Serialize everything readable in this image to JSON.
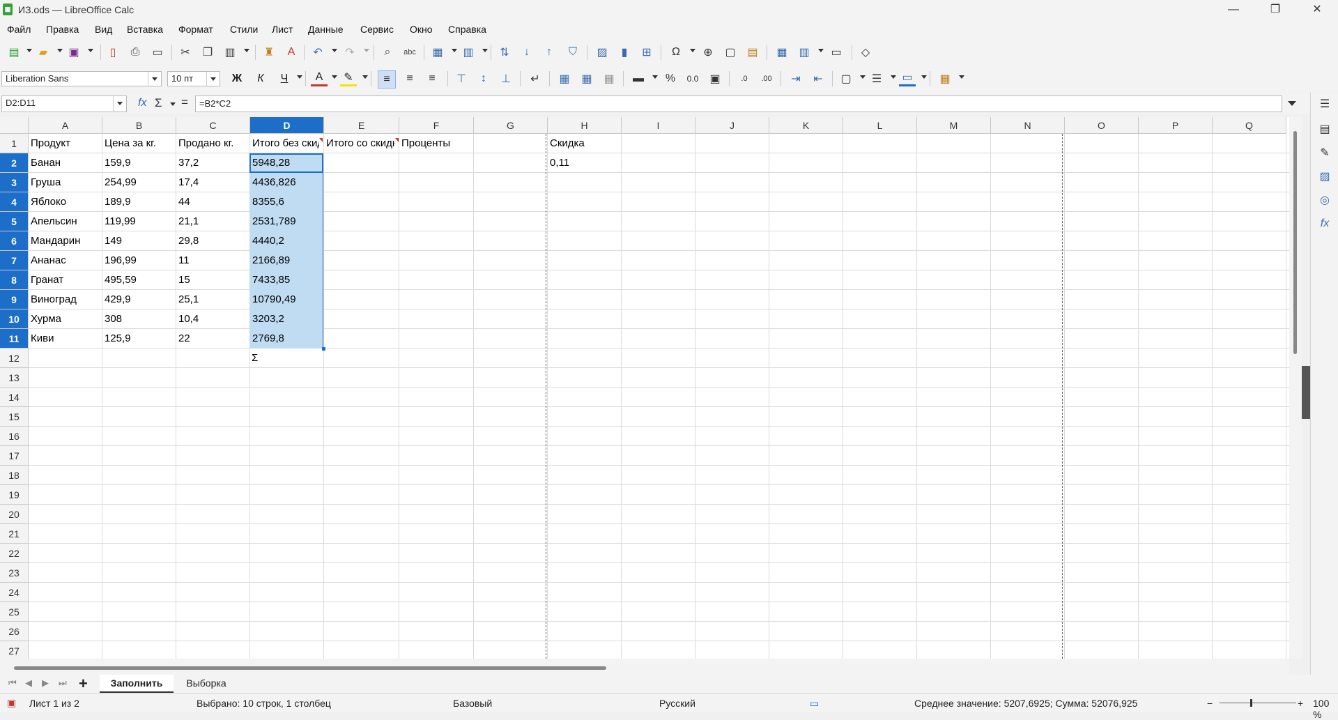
{
  "window": {
    "title": "ИЗ.ods — LibreOffice Calc",
    "minimize": "—",
    "restore": "❐",
    "close": "✕"
  },
  "menu": [
    "Файл",
    "Правка",
    "Вид",
    "Вставка",
    "Формат",
    "Стили",
    "Лист",
    "Данные",
    "Сервис",
    "Окно",
    "Справка"
  ],
  "format_bar": {
    "font_name": "Liberation Sans",
    "font_size": "10 пт",
    "bold": "Ж",
    "italic": "К",
    "underline": "Ч",
    "percent": "%",
    "number": "0.0"
  },
  "formula_bar": {
    "name_box": "D2:D11",
    "fx": "fx",
    "sigma": "Σ",
    "equals": "=",
    "formula": "=B2*C2"
  },
  "columns": [
    "A",
    "B",
    "C",
    "D",
    "E",
    "F",
    "G",
    "H",
    "I",
    "J",
    "K",
    "L",
    "M",
    "N",
    "O",
    "P",
    "Q"
  ],
  "selected_column": "D",
  "rows": [
    "1",
    "2",
    "3",
    "4",
    "5",
    "6",
    "7",
    "8",
    "9",
    "10",
    "11",
    "12",
    "13",
    "14",
    "15",
    "16",
    "17",
    "18",
    "19",
    "20",
    "21",
    "22",
    "23",
    "24",
    "25",
    "26",
    "27"
  ],
  "header_row": {
    "A": "Продукт",
    "B": "Цена за кг.",
    "C": "Продано кг.",
    "D": "Итого без скидки",
    "E": "Итого со скидкой",
    "F": "Проценты",
    "H": "Скидка"
  },
  "data_rows": [
    {
      "A": "Банан",
      "B": "159,9",
      "C": "37,2",
      "D": "5948,28",
      "H": "0,11"
    },
    {
      "A": "Груша",
      "B": "254,99",
      "C": "17,4",
      "D": "4436,826"
    },
    {
      "A": "Яблоко",
      "B": "189,9",
      "C": "44",
      "D": "8355,6"
    },
    {
      "A": "Апельсин",
      "B": "119,99",
      "C": "21,1",
      "D": "2531,789"
    },
    {
      "A": "Мандарин",
      "B": "149",
      "C": "29,8",
      "D": "4440,2"
    },
    {
      "A": "Ананас",
      "B": "196,99",
      "C": "11",
      "D": "2166,89"
    },
    {
      "A": "Гранат",
      "B": "495,59",
      "C": "15",
      "D": "7433,85"
    },
    {
      "A": "Виноград",
      "B": "429,9",
      "C": "25,1",
      "D": "10790,49"
    },
    {
      "A": "Хурма",
      "B": "308",
      "C": "10,4",
      "D": "3203,2"
    },
    {
      "A": "Киви",
      "B": "125,9",
      "C": "22",
      "D": "2769,8"
    }
  ],
  "autosum_hint": "Σ",
  "sheet_tabs": {
    "add": "+",
    "tabs": [
      "Заполнить",
      "Выборка"
    ],
    "active": "Заполнить"
  },
  "status": {
    "sheet": "Лист 1 из 2",
    "selection": "Выбрано: 10 строк, 1 столбец",
    "style": "Базовый",
    "language": "Русский",
    "stats": "Среднее значение: 5207,6925; Сумма: 52076,925",
    "zoom": "100 %"
  },
  "colors": {
    "accent": "#1c6ec9",
    "selection_fill": "#c0dcf3",
    "app_green": "#34a13b"
  }
}
